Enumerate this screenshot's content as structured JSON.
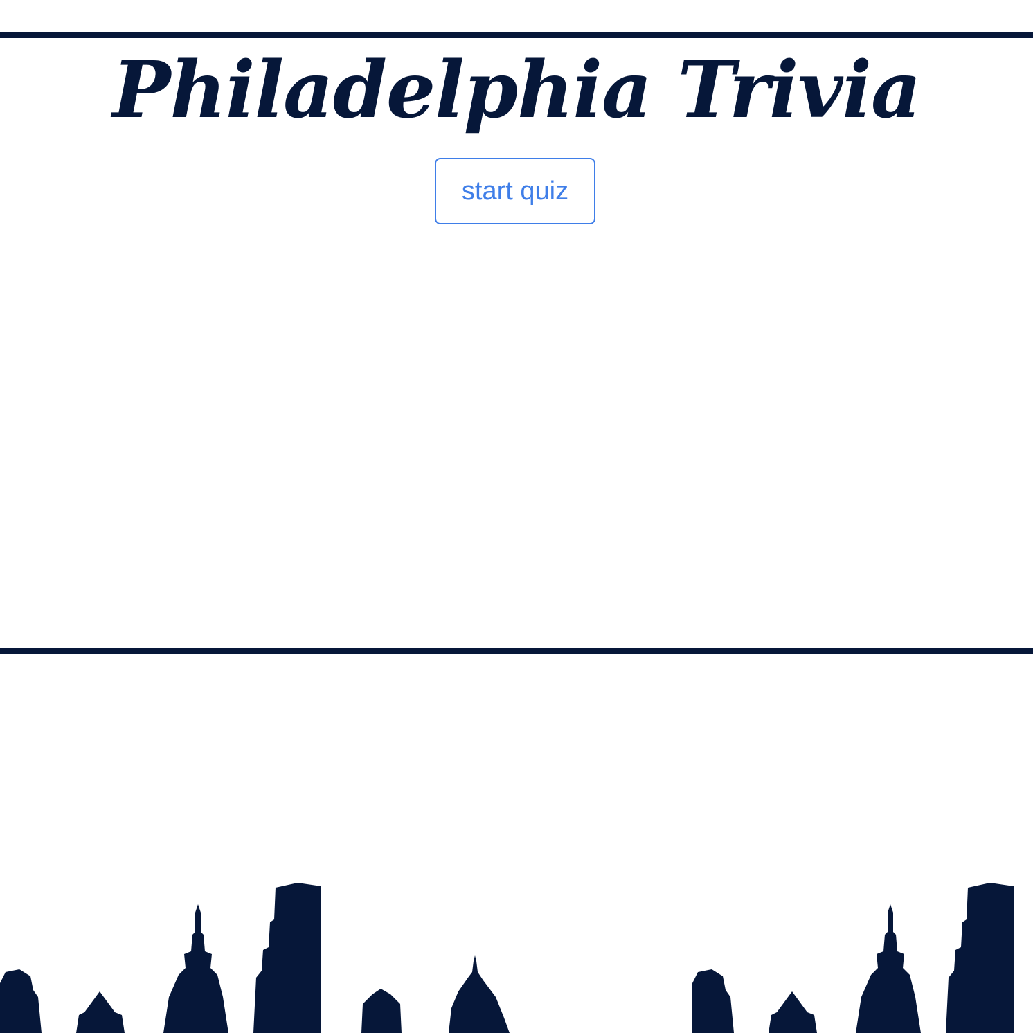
{
  "header": {
    "title": "Philadelphia Trivia"
  },
  "actions": {
    "start_label": "start quiz"
  },
  "colors": {
    "primary": "#061739",
    "accent": "#3f7ee8",
    "background": "#ffffff"
  },
  "icons": {
    "skyline": "philadelphia-skyline-silhouette"
  }
}
